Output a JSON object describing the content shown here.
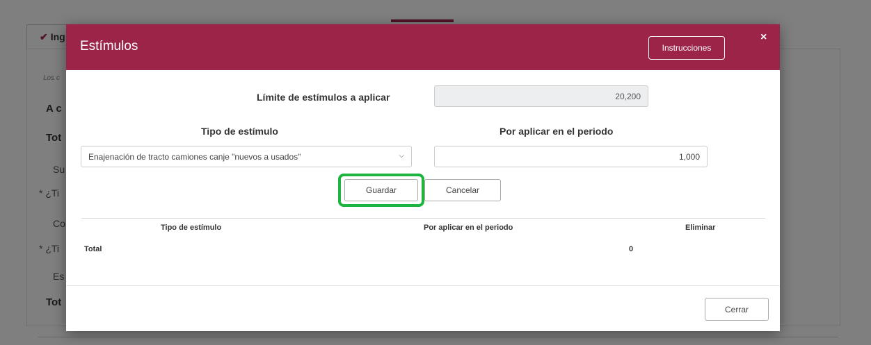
{
  "background": {
    "tab_label": "Ing",
    "italic_note": "Los c",
    "rows": [
      "A c",
      "Tot",
      "Su",
      "* ¿Ti",
      "Co",
      "* ¿Ti",
      "Es",
      "Tot"
    ]
  },
  "modal": {
    "title": "Estímulos",
    "instructions_button": "Instrucciones",
    "close_icon": "×",
    "limit_label": "Límite de estímulos a aplicar",
    "limit_value": "20,200",
    "tipo_label": "Tipo de estímulo",
    "tipo_selected": "Enajenación de tracto camiones canje \"nuevos a usados\"",
    "por_aplicar_label": "Por aplicar en el periodo",
    "por_aplicar_value": "1,000",
    "save_button": "Guardar",
    "cancel_button": "Cancelar",
    "table": {
      "headers": [
        "Tipo de estímulo",
        "Por aplicar en el periodo",
        "Eliminar"
      ],
      "total_label": "Total",
      "total_value": "0"
    },
    "footer_close_button": "Cerrar"
  },
  "colors": {
    "brand": "#9d2449",
    "highlight": "#1db440"
  }
}
